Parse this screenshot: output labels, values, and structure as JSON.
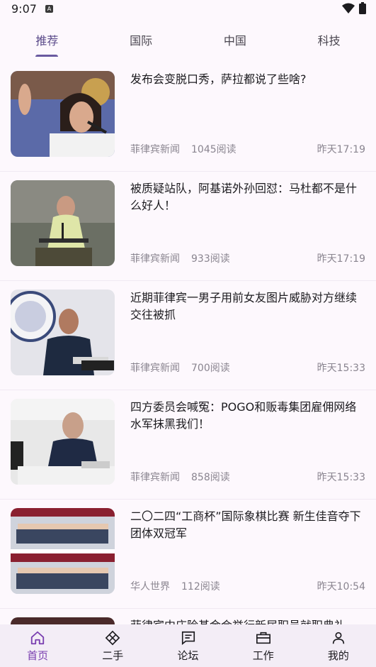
{
  "status": {
    "time": "9:07"
  },
  "tabs": [
    {
      "label": "推荐",
      "active": true
    },
    {
      "label": "国际",
      "active": false
    },
    {
      "label": "中国",
      "active": false
    },
    {
      "label": "科技",
      "active": false
    }
  ],
  "news": [
    {
      "title": "发布会变脱口秀，萨拉都说了些啥?",
      "source": "菲律宾新闻",
      "reads": "1045阅读",
      "time": "昨天17:19"
    },
    {
      "title": "被质疑站队，阿基诺外孙回怼：马杜都不是什么好人！",
      "source": "菲律宾新闻",
      "reads": "933阅读",
      "time": "昨天17:19"
    },
    {
      "title": "近期菲律宾一男子用前女友图片威胁对方继续交往被抓",
      "source": "菲律宾新闻",
      "reads": "700阅读",
      "time": "昨天15:33"
    },
    {
      "title": "四方委员会喊冤：POGO和贩毒集团雇佣网络水军抹黑我们！",
      "source": "菲律宾新闻",
      "reads": "858阅读",
      "time": "昨天15:33"
    },
    {
      "title": "二〇二四“工商杯”国际象棋比赛 新生佳音夺下团体双冠军",
      "source": "华人世界",
      "reads": "112阅读",
      "time": "昨天10:54"
    }
  ],
  "partial_news": {
    "title": "菲律宾中庄险基金会举行新届职员就职典礼"
  },
  "bottom_nav": [
    {
      "label": "首页",
      "icon": "home-icon",
      "active": true
    },
    {
      "label": "二手",
      "icon": "diamond-icon",
      "active": false
    },
    {
      "label": "论坛",
      "icon": "chat-icon",
      "active": false
    },
    {
      "label": "工作",
      "icon": "briefcase-icon",
      "active": false
    },
    {
      "label": "我的",
      "icon": "person-icon",
      "active": false
    }
  ]
}
